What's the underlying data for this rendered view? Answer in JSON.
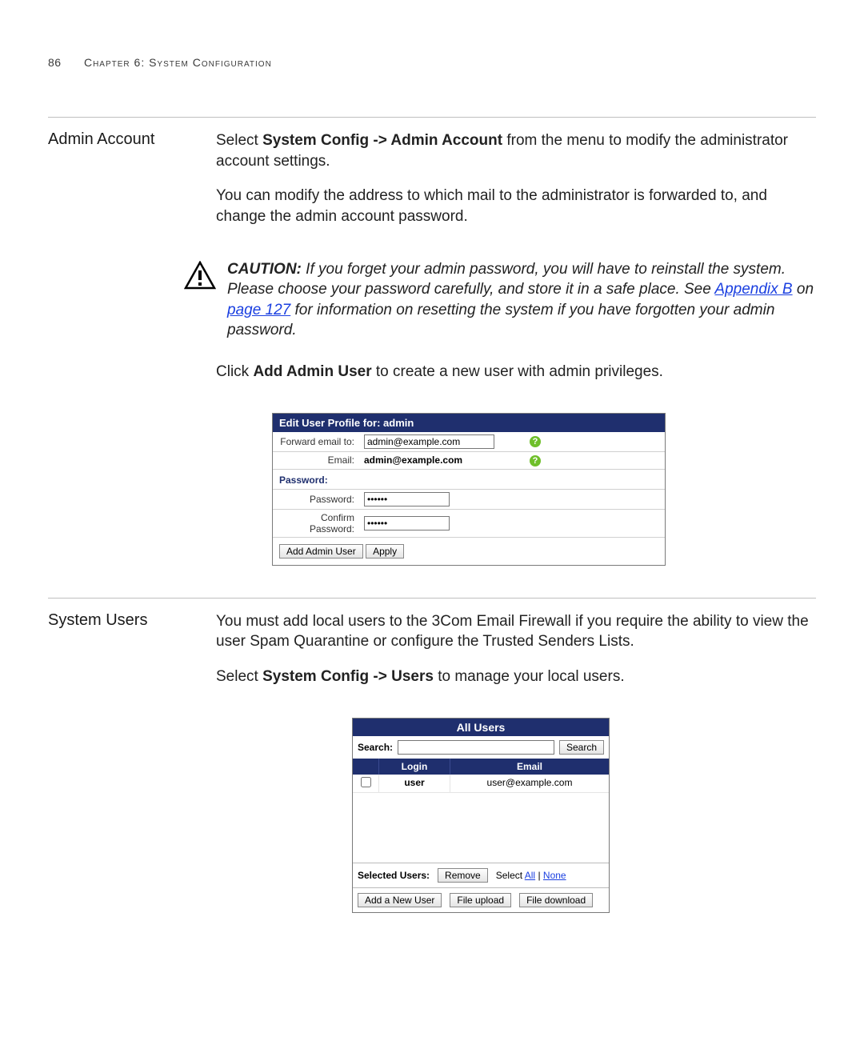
{
  "header": {
    "page_number": "86",
    "chapter_label": "Chapter 6: System Configuration"
  },
  "admin": {
    "heading": "Admin Account",
    "para1_pre": "Select ",
    "para1_bold": "System Config -> Admin Account",
    "para1_post": " from the menu to modify the administrator account settings.",
    "para2": "You can modify the address to which mail to the administrator is forwarded to, and change the admin account password.",
    "caution": {
      "label": "CAUTION:",
      "t1": " If you forget your admin password, you will have to reinstall the system. Please choose your password carefully, and store it in a safe place. See ",
      "link1": "Appendix B",
      "t2": " on ",
      "link2": "page 127",
      "t3": " for information on resetting the system if you have forgotten your admin password."
    },
    "para3_pre": "Click ",
    "para3_bold": "Add Admin User",
    "para3_post": " to create a new user with admin privileges.",
    "profile": {
      "title": "Edit User Profile for: admin",
      "forward_label": "Forward email to:",
      "forward_value": "admin@example.com",
      "email_label": "Email:",
      "email_value": "admin@example.com",
      "pw_section": "Password:",
      "pw_label": "Password:",
      "pw_value": "******",
      "cpw_label": "Confirm Password:",
      "cpw_value": "******",
      "btn_add": "Add Admin User",
      "btn_apply": "Apply"
    }
  },
  "users": {
    "heading": "System Users",
    "para1": "You must add local users to the 3Com Email Firewall if you require the ability to view the user Spam Quarantine or configure the Trusted Senders Lists.",
    "para2_pre": "Select ",
    "para2_bold": "System Config -> Users",
    "para2_post": " to manage your local users.",
    "panel": {
      "title": "All Users",
      "search_label": "Search:",
      "search_value": "",
      "search_btn": "Search",
      "col_login": "Login",
      "col_email": "Email",
      "rows": [
        {
          "login": "user",
          "email": "user@example.com"
        }
      ],
      "selected_label": "Selected Users:",
      "btn_remove": "Remove",
      "select_prefix": "Select ",
      "select_all": "All",
      "select_sep": " | ",
      "select_none": "None",
      "btn_add": "Add a New User",
      "btn_upload": "File upload",
      "btn_download": "File download"
    }
  }
}
